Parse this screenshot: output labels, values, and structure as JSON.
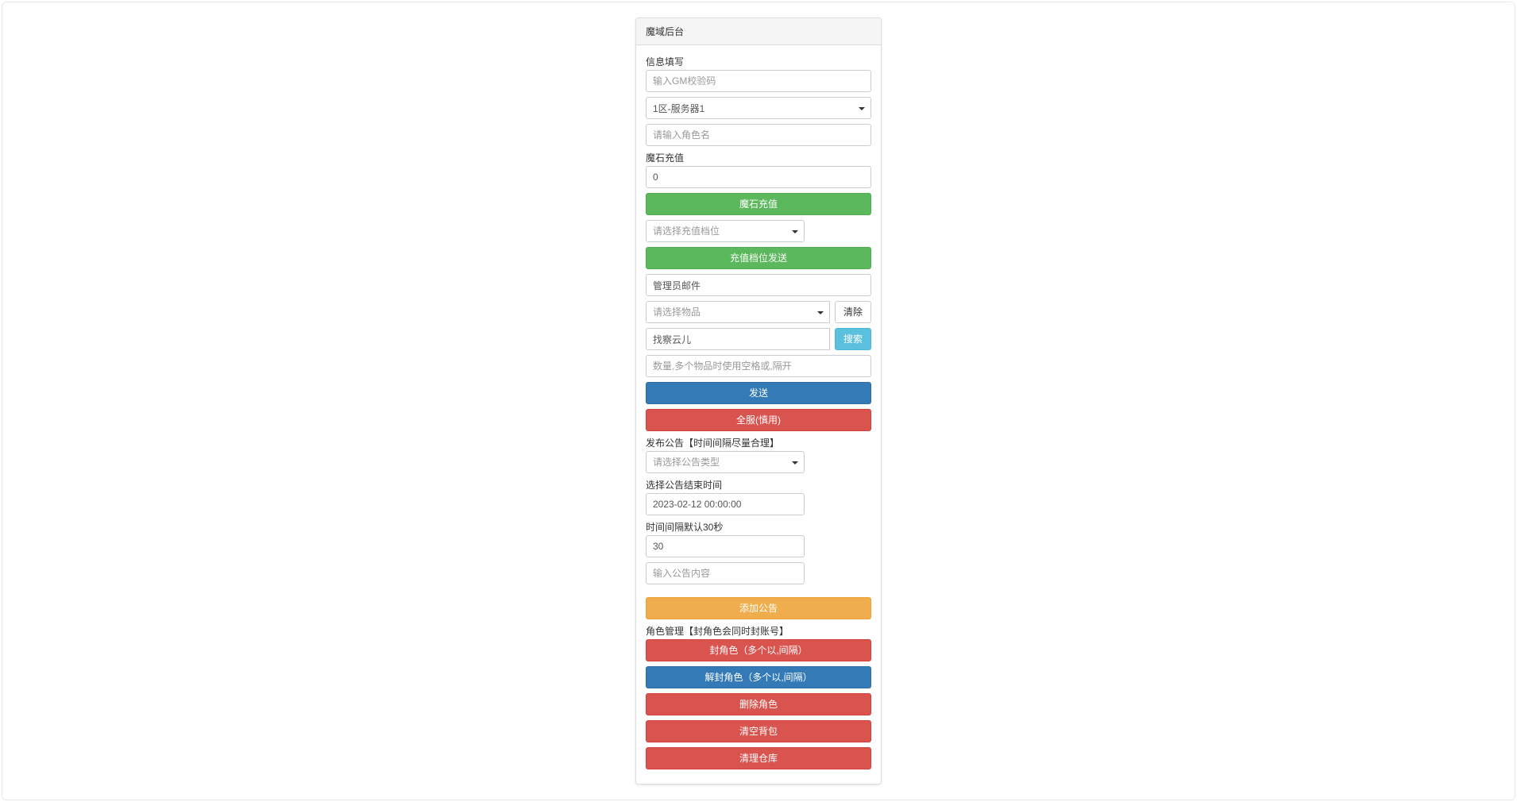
{
  "panel_title": "魔域后台",
  "info": {
    "label": "信息填写",
    "gm_code_placeholder": "输入GM校验码",
    "server_selected": "1区-服务器1",
    "role_placeholder": "请输入角色名"
  },
  "stone": {
    "label": "魔石充值",
    "value": "0",
    "btn": "魔石充值",
    "slot_placeholder": "请选择充值档位",
    "slot_btn": "充值档位发送"
  },
  "mail": {
    "value": "管理员邮件",
    "item_placeholder": "请选择物品",
    "clear_btn": "清除",
    "search_value": "找察云儿",
    "search_btn": "搜索",
    "qty_placeholder": "数量,多个物品时使用空格或,隔开",
    "send_btn": "发送",
    "global_btn": "全服(慎用)"
  },
  "notice": {
    "label": "发布公告【时间间隔尽量合理】",
    "type_placeholder": "请选择公告类型",
    "end_label": "选择公告结束时间",
    "end_value": "2023-02-12 00:00:00",
    "interval_label": "时间间隔默认30秒",
    "interval_value": "30",
    "content_placeholder": "输入公告内容",
    "add_btn": "添加公告"
  },
  "role": {
    "label": "角色管理【封角色会同时封账号】",
    "ban_btn": "封角色（多个以,间隔）",
    "unban_btn": "解封角色（多个以,间隔）",
    "delete_btn": "删除角色",
    "clear_bag_btn": "清空背包",
    "clear_storage_btn": "清理仓库"
  }
}
